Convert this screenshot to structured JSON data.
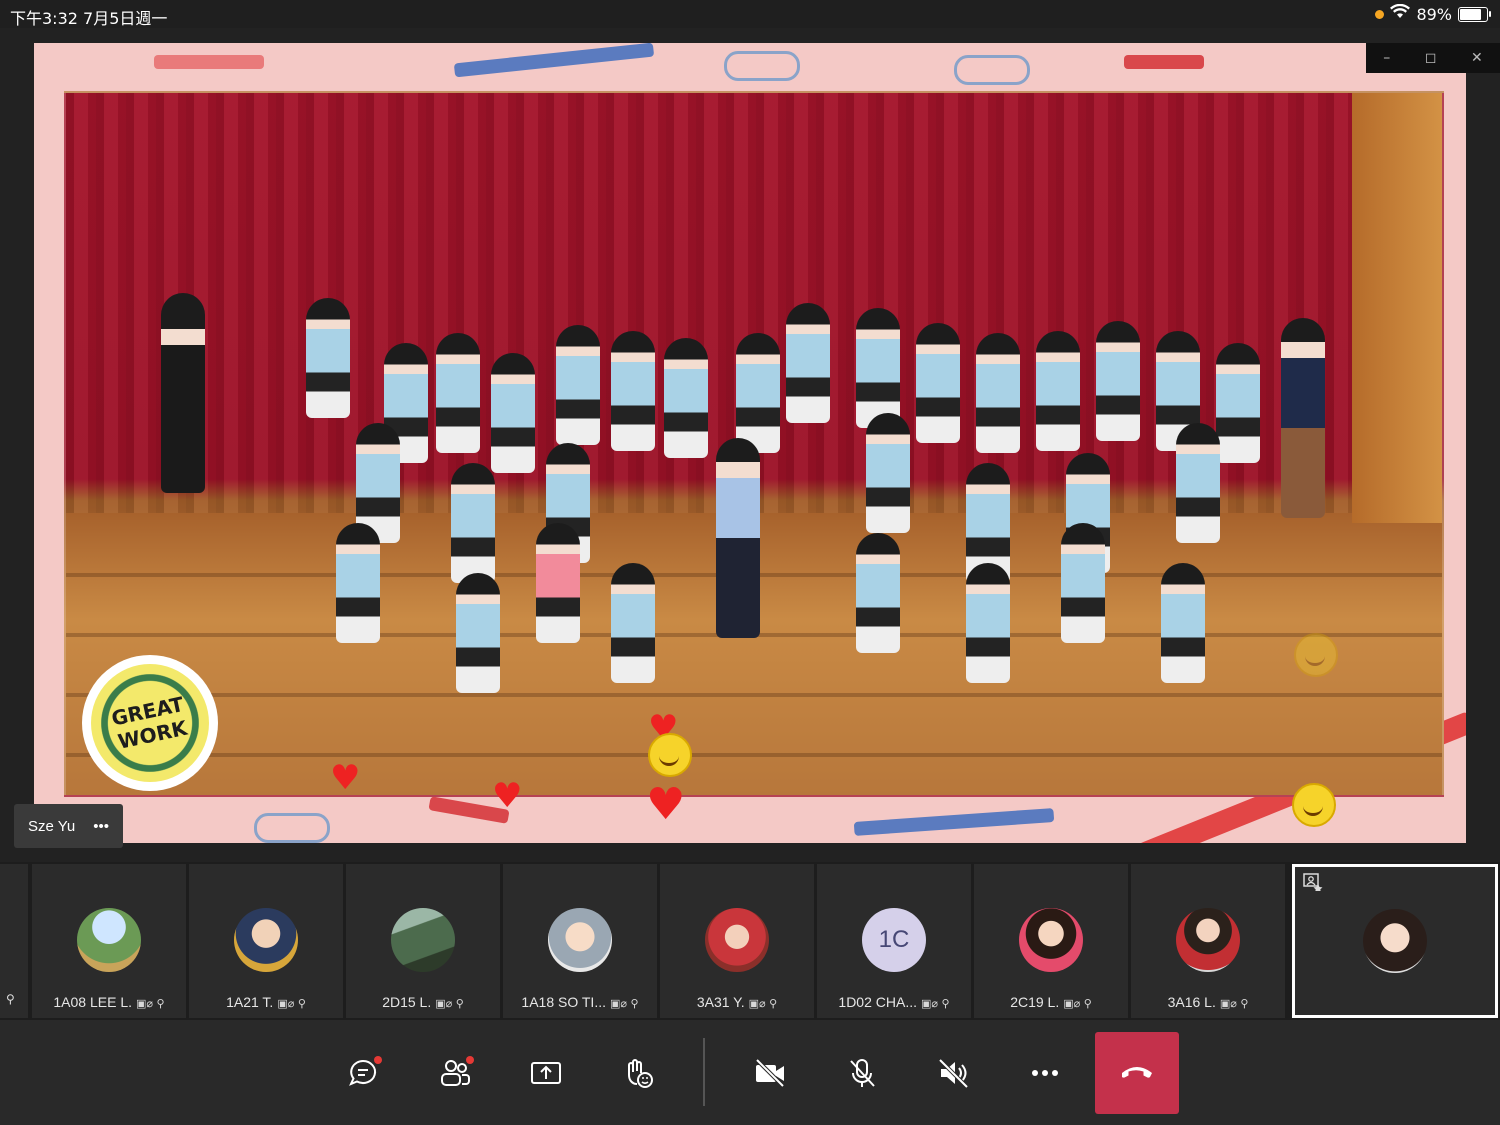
{
  "status_bar": {
    "time_date": "下午3:32   7月5日週一",
    "battery_percent": "89%",
    "battery_level": 0.89
  },
  "meeting": {
    "speaker_name": "Sze Yu",
    "speaker_more": "•••",
    "sticker_text": "GREAT WORK"
  },
  "window_controls": {
    "minimize": "–",
    "restore": "◻",
    "close": "✕"
  },
  "participants": [
    {
      "name": "1A08 LEE L.",
      "icons": "▣⌀ ⚲"
    },
    {
      "name": "1A21 T.",
      "icons": "▣⌀ ⚲"
    },
    {
      "name": "2D15 L.",
      "icons": "▣⌀ ⚲"
    },
    {
      "name": "1A18 SO TI...",
      "icons": "▣⌀ ⚲"
    },
    {
      "name": "3A31 Y.",
      "icons": "▣⌀ ⚲"
    },
    {
      "name": "1D02 CHA...",
      "icons": "▣⌀ ⚲",
      "initials": "1C"
    },
    {
      "name": "2C19 L.",
      "icons": "▣⌀ ⚲"
    },
    {
      "name": "3A16 L.",
      "icons": "▣⌀ ⚲"
    }
  ],
  "toolbar": {
    "chat_icon": "chat-icon",
    "participants_icon": "people-icon",
    "share_icon": "share-screen-icon",
    "reactions_icon": "raise-hand-icon",
    "camera_icon": "camera-off-icon",
    "mic_icon": "mic-off-icon",
    "speaker_icon": "speaker-off-icon",
    "more_icon": "more-icon",
    "hangup_icon": "hang-up-icon"
  },
  "colors": {
    "hangup": "#c4314b",
    "notify_dot": "#e53935",
    "background": "#292929"
  }
}
